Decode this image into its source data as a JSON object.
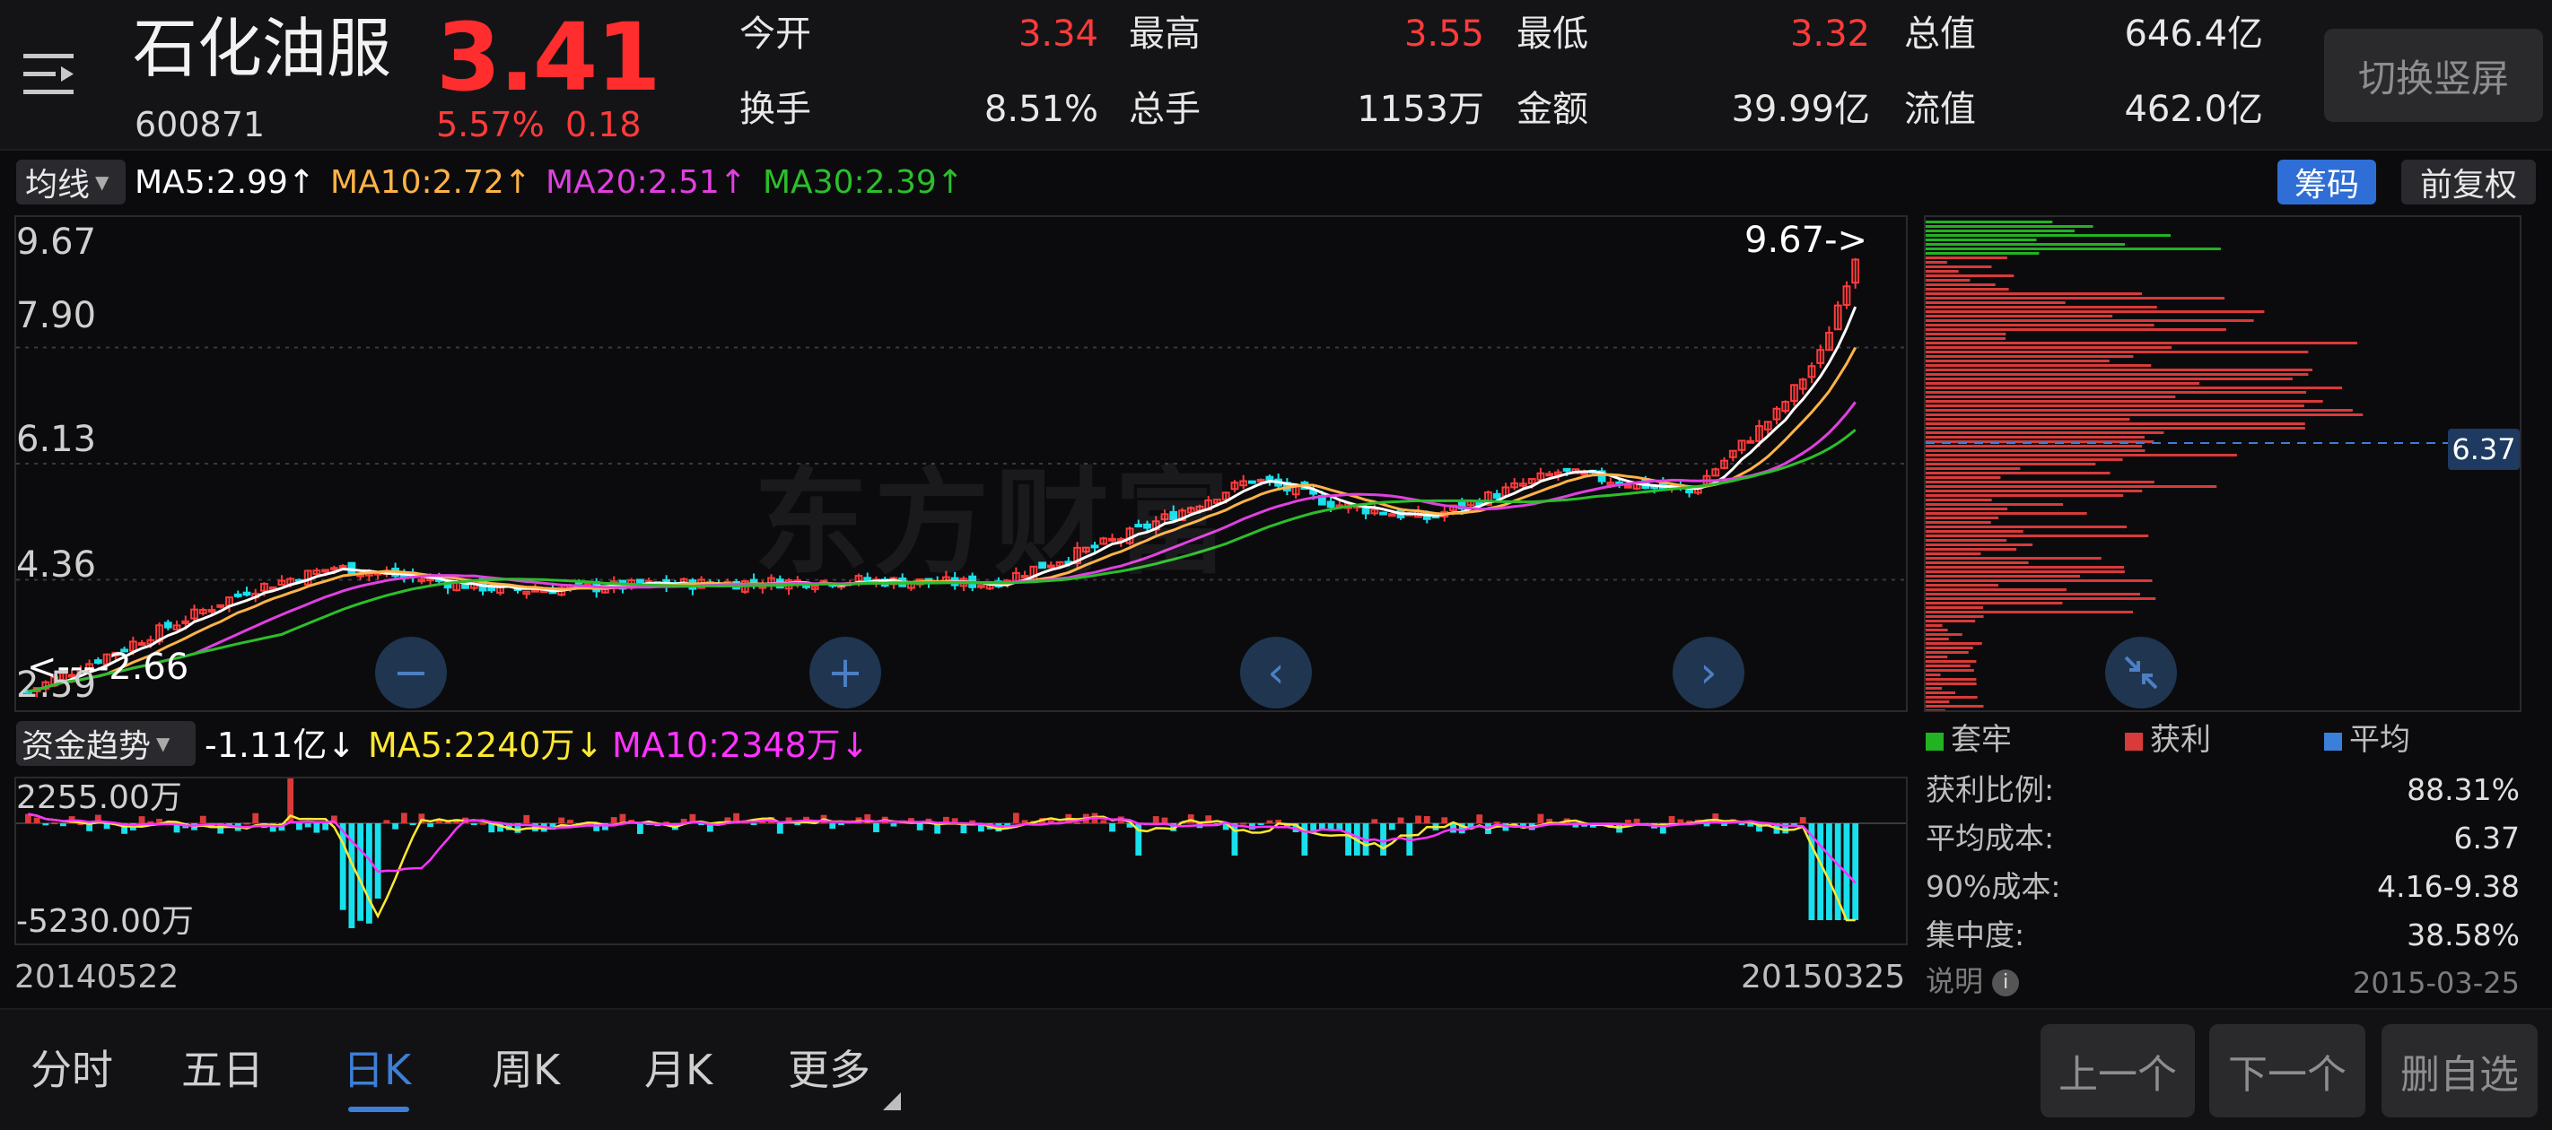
{
  "header": {
    "stock_name": "石化油服",
    "stock_code": "600871",
    "price": "3.41",
    "change_pct": "5.57%",
    "change_abs": "0.18",
    "quotes": [
      {
        "label": "今开",
        "value": "3.34",
        "color": "#ff3b3b"
      },
      {
        "label": "最高",
        "value": "3.55",
        "color": "#ff3b3b"
      },
      {
        "label": "最低",
        "value": "3.32",
        "color": "#ff3b3b"
      },
      {
        "label": "总值",
        "value": "646.4亿",
        "color": "#e8e8e8"
      },
      {
        "label": "换手",
        "value": "8.51%",
        "color": "#e8e8e8"
      },
      {
        "label": "总手",
        "value": "1153万",
        "color": "#e8e8e8"
      },
      {
        "label": "金额",
        "value": "39.99亿",
        "color": "#e8e8e8"
      },
      {
        "label": "流值",
        "value": "462.0亿",
        "color": "#e8e8e8"
      }
    ],
    "switch_button": "切换竖屏"
  },
  "kline": {
    "indicator_dropdown": "均线",
    "ma_legend": [
      {
        "text": "MA5:2.99↑",
        "color": "#ffffff"
      },
      {
        "text": "MA10:2.72↑",
        "color": "#ffb347"
      },
      {
        "text": "MA20:2.51↑",
        "color": "#e040e0"
      },
      {
        "text": "MA30:2.39↑",
        "color": "#2bbf2b"
      }
    ],
    "chips_button": "筹码",
    "adjust_button": "前复权",
    "y_labels": [
      "9.67",
      "7.90",
      "6.13",
      "4.36",
      "2.59"
    ],
    "max_marker": "9.67->",
    "min_marker": "<----2.66",
    "chip_price_tag": "6.37",
    "watermark": "东方财富"
  },
  "fund_flow": {
    "dropdown": "资金趋势",
    "legend": [
      {
        "text": "-1.11亿↓",
        "color": "#ffffff"
      },
      {
        "text": "MA5:2240万↓",
        "color": "#ffe833"
      },
      {
        "text": "MA10:2348万↓",
        "color": "#ff33ff"
      }
    ],
    "y_top": "2255.00万",
    "y_bottom": "-5230.00万",
    "date_start": "20140522",
    "date_end": "20150325"
  },
  "chips": {
    "legend": [
      {
        "text": "套牢",
        "color": "#22b322"
      },
      {
        "text": "获利",
        "color": "#d93a3a"
      },
      {
        "text": "平均",
        "color": "#3a7fd9"
      }
    ],
    "stats": [
      {
        "label": "获利比例:",
        "value": "88.31%"
      },
      {
        "label": "平均成本:",
        "value": "6.37"
      },
      {
        "label": "90%成本:",
        "value": "4.16-9.38"
      },
      {
        "label": "集中度:",
        "value": "38.58%"
      }
    ],
    "note_label": "说明",
    "note_date": "2015-03-25"
  },
  "bottom": {
    "tabs": [
      "分时",
      "五日",
      "日K",
      "周K",
      "月K",
      "更多"
    ],
    "active_tab": "日K",
    "prev_button": "上一个",
    "next_button": "下一个",
    "remove_button": "删自选"
  }
}
